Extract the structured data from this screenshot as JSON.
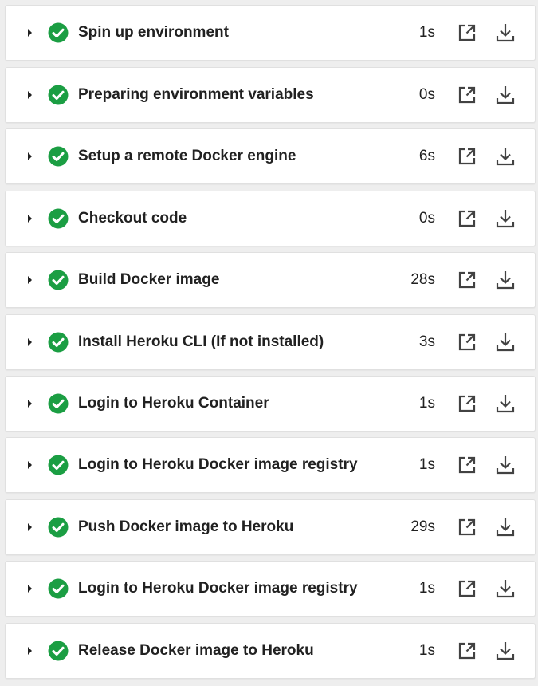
{
  "colors": {
    "success": "#1b9e43",
    "text": "#212121",
    "icon": "#424242",
    "background": "#eeeeee",
    "card": "#ffffff"
  },
  "icons": {
    "expand": "caret-right-icon",
    "status": "check-circle-icon",
    "open": "open-in-new-icon",
    "download": "download-icon"
  },
  "steps": [
    {
      "name": "Spin up environment",
      "duration": "1s",
      "status": "success"
    },
    {
      "name": "Preparing environment variables",
      "duration": "0s",
      "status": "success"
    },
    {
      "name": "Setup a remote Docker engine",
      "duration": "6s",
      "status": "success"
    },
    {
      "name": "Checkout code",
      "duration": "0s",
      "status": "success"
    },
    {
      "name": "Build Docker image",
      "duration": "28s",
      "status": "success"
    },
    {
      "name": "Install Heroku CLI (If not installed)",
      "duration": "3s",
      "status": "success"
    },
    {
      "name": "Login to Heroku Container",
      "duration": "1s",
      "status": "success"
    },
    {
      "name": "Login to Heroku Docker image registry",
      "duration": "1s",
      "status": "success"
    },
    {
      "name": "Push Docker image to Heroku",
      "duration": "29s",
      "status": "success"
    },
    {
      "name": "Login to Heroku Docker image registry",
      "duration": "1s",
      "status": "success"
    },
    {
      "name": "Release Docker image to Heroku",
      "duration": "1s",
      "status": "success"
    }
  ]
}
